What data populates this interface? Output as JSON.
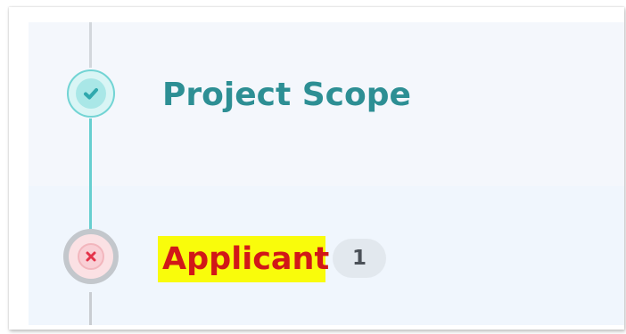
{
  "steps": [
    {
      "title": "Project Scope",
      "status": "complete",
      "icon": "check-icon"
    },
    {
      "title": "Applicant",
      "status": "error",
      "icon": "x-icon",
      "error_count": "1"
    }
  ],
  "colors": {
    "complete_text": "#2d8f94",
    "complete_line": "#67cfd0",
    "error_text": "#d11818",
    "highlight": "#f9fc0b",
    "badge_bg": "#e2e8ee"
  }
}
